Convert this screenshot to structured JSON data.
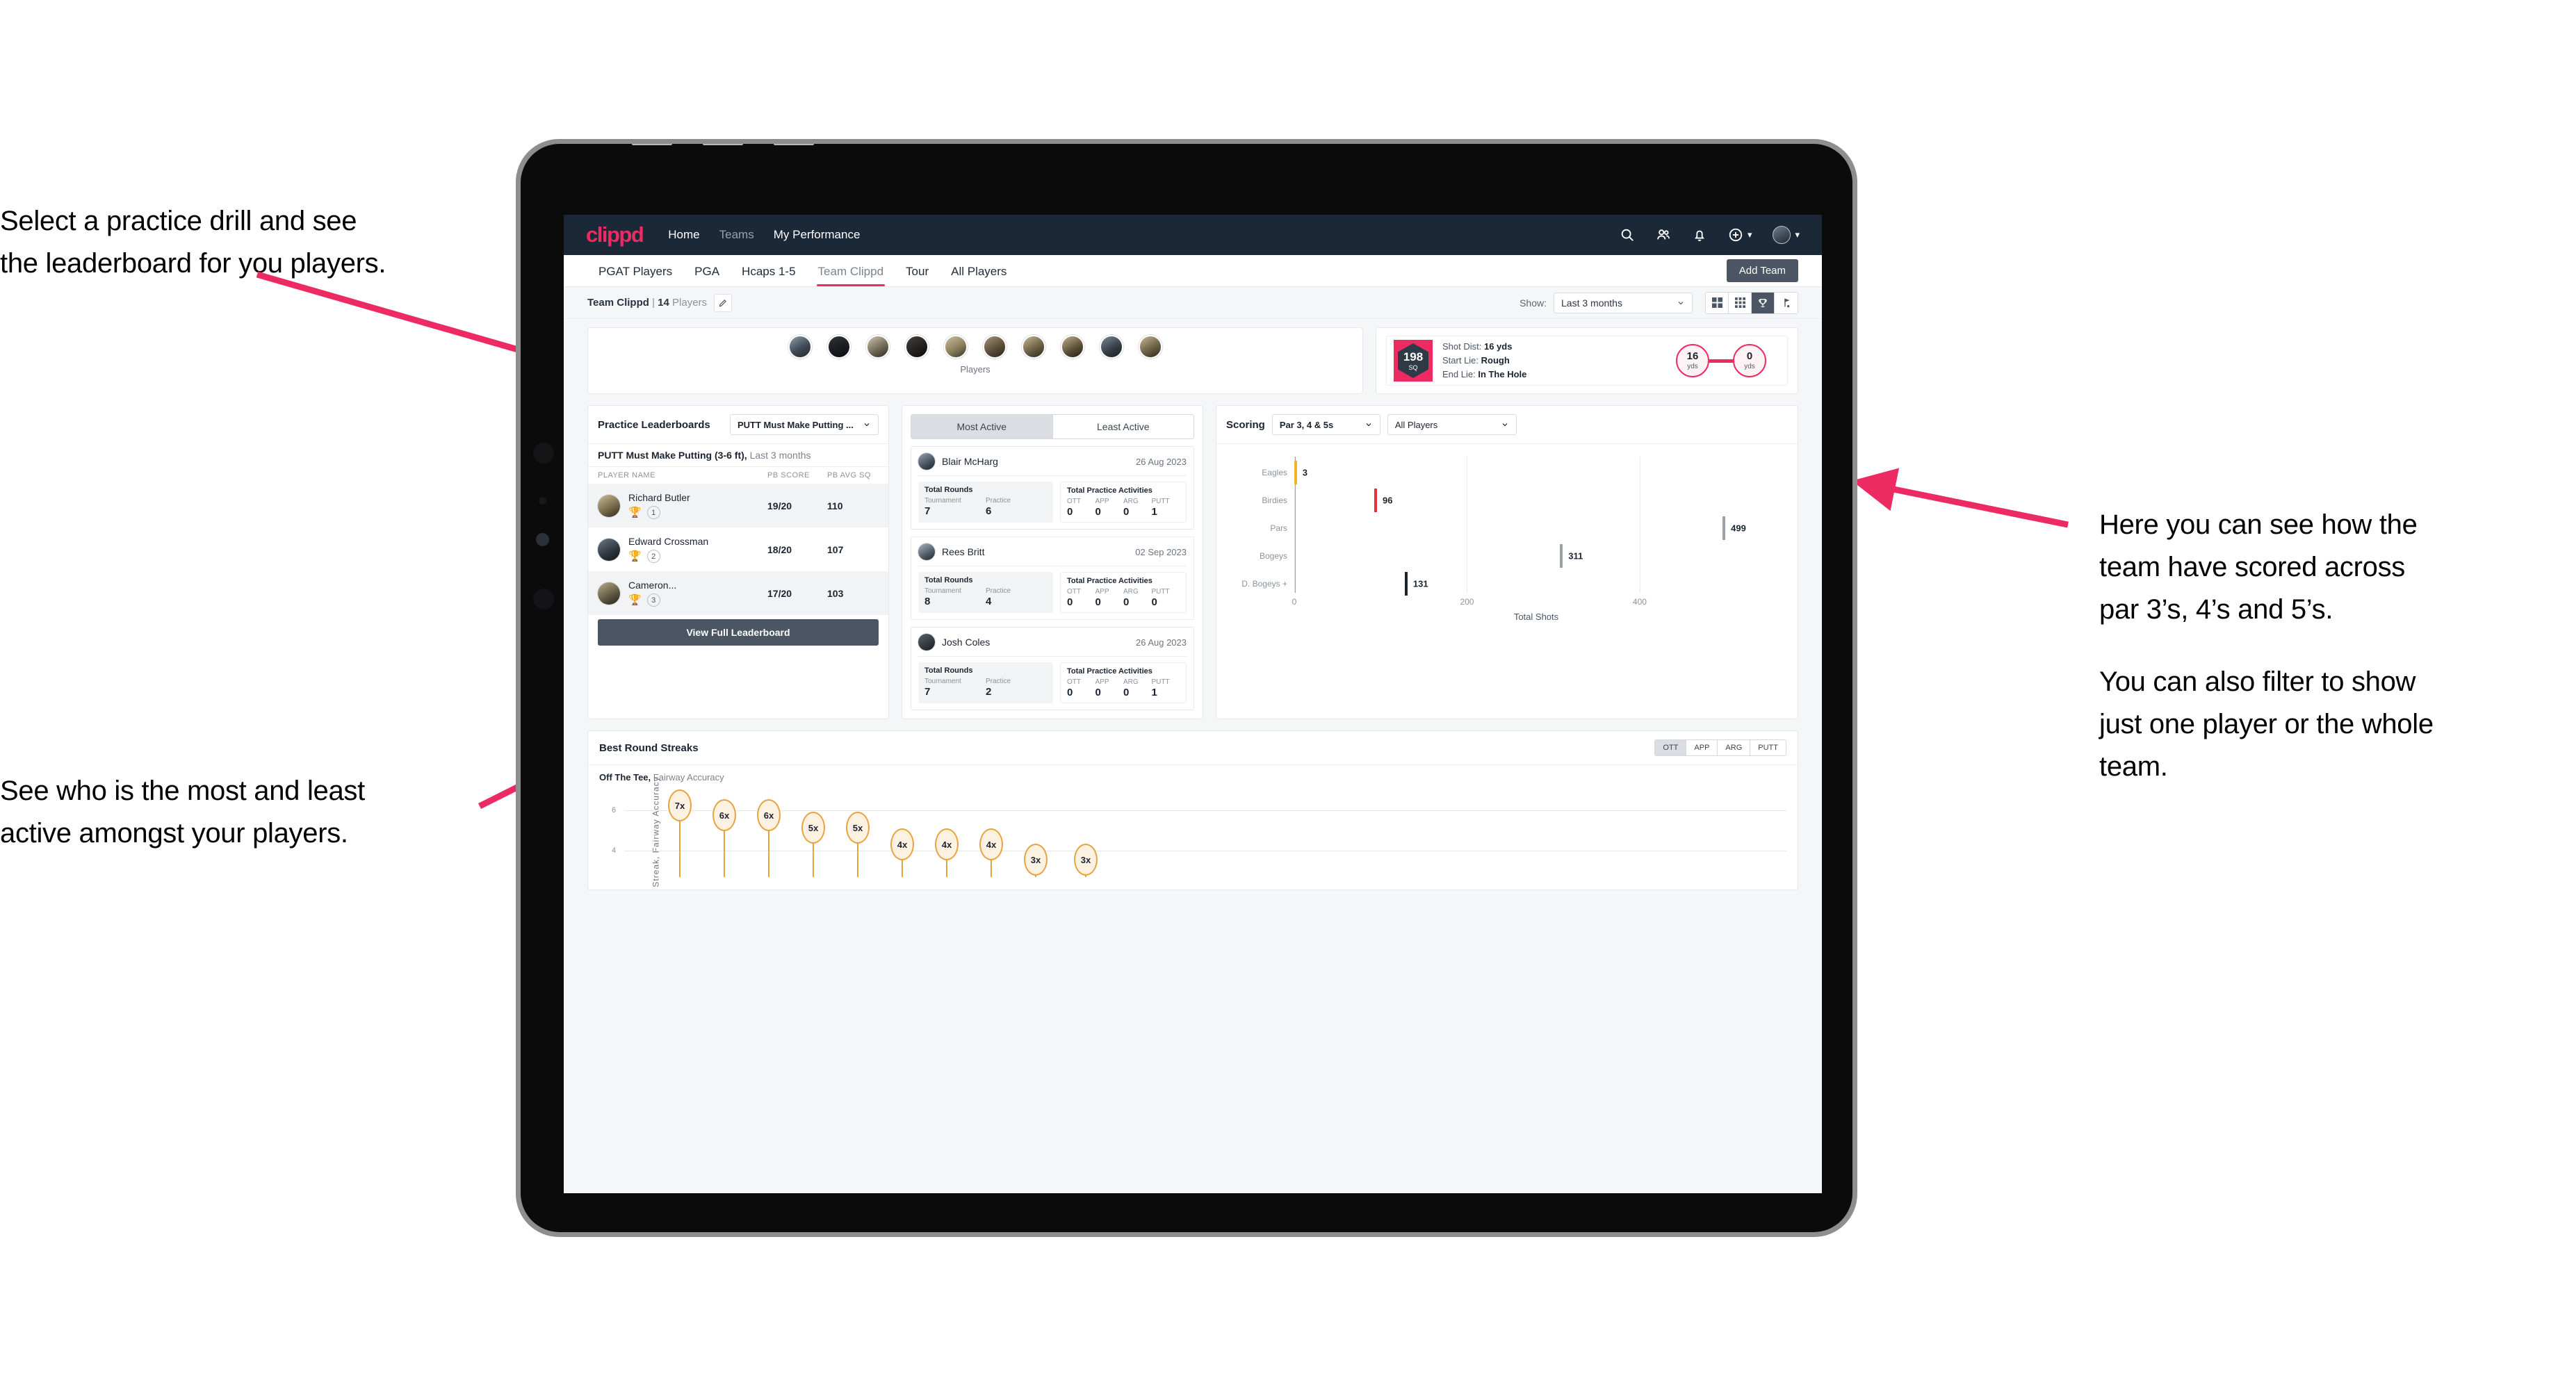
{
  "annotations": {
    "top_left": [
      "Select a practice drill and see",
      "the leaderboard for you players."
    ],
    "bottom_left": [
      "See who is the most and least",
      "active amongst your players."
    ],
    "right_p1": [
      "Here you can see how the",
      "team have scored across",
      "par 3’s, 4’s and 5’s."
    ],
    "right_p2": [
      "You can also filter to show",
      "just one player or the whole",
      "team."
    ],
    "arrow_color": "#ec2b62"
  },
  "app": {
    "logo": "clippd",
    "brand_color": "#ec2b62",
    "header_bg": "#1b2838",
    "nav": [
      {
        "label": "Home",
        "active": true
      },
      {
        "label": "Teams",
        "active": false
      },
      {
        "label": "My Performance",
        "active": true
      }
    ],
    "header_icons": [
      "search-icon",
      "people-icon",
      "bell-icon",
      "plus-circle-icon",
      "avatar"
    ],
    "tabs": [
      {
        "label": "PGAT Players",
        "active": false
      },
      {
        "label": "PGA",
        "active": false
      },
      {
        "label": "Hcaps 1-5",
        "active": false
      },
      {
        "label": "Team Clippd",
        "active": true
      },
      {
        "label": "Tour",
        "active": false
      },
      {
        "label": "All Players",
        "active": false
      }
    ],
    "add_team_label": "Add Team"
  },
  "subbar": {
    "team_name": "Team Clippd",
    "separator": "|",
    "player_count": "14",
    "players_word": "Players",
    "edit_icon": "pencil-icon",
    "show_label": "Show:",
    "range_value": "Last 3 months",
    "view_toggle": [
      {
        "icon": "grid-2x2-icon",
        "active": false
      },
      {
        "icon": "grid-3x3-icon",
        "active": false
      },
      {
        "icon": "trophy-icon",
        "active": true
      },
      {
        "icon": "flag-icon",
        "active": false
      }
    ]
  },
  "players_card": {
    "caption": "Players",
    "avatar_count": 10
  },
  "shot_card": {
    "sq_value": "198",
    "sq_unit": "SQ",
    "lines": [
      {
        "label": "Shot Dist:",
        "value": "16 yds"
      },
      {
        "label": "Start Lie:",
        "value": "Rough"
      },
      {
        "label": "End Lie:",
        "value": "In The Hole"
      }
    ],
    "start": {
      "value": "16",
      "unit": "yds"
    },
    "end": {
      "value": "0",
      "unit": "yds"
    }
  },
  "leaderboard": {
    "title": "Practice Leaderboards",
    "drill_select": "PUTT Must Make Putting ...",
    "subtitle_bold": "PUTT Must Make Putting (3-6 ft),",
    "subtitle_grey": "Last 3 months",
    "columns": [
      "PLAYER NAME",
      "PB SCORE",
      "PB AVG SQ"
    ],
    "rows": [
      {
        "name": "Richard Butler",
        "rank": "1",
        "trophy": "gold",
        "pb_score": "19/20",
        "pb_avg_sq": "110"
      },
      {
        "name": "Edward Crossman",
        "rank": "2",
        "trophy": "silver",
        "pb_score": "18/20",
        "pb_avg_sq": "107"
      },
      {
        "name": "Cameron...",
        "rank": "3",
        "trophy": "bronze",
        "pb_score": "17/20",
        "pb_avg_sq": "103"
      }
    ],
    "button_label": "View Full Leaderboard"
  },
  "activity": {
    "tabs": [
      {
        "label": "Most Active",
        "active": true
      },
      {
        "label": "Least Active",
        "active": false
      }
    ],
    "rounds_title": "Total Rounds",
    "rounds_cols": [
      "Tournament",
      "Practice"
    ],
    "practice_title": "Total Practice Activities",
    "practice_cols": [
      "OTT",
      "APP",
      "ARG",
      "PUTT"
    ],
    "players": [
      {
        "name": "Blair McHarg",
        "date": "26 Aug 2023",
        "tournament": "7",
        "practice": "6",
        "ott": "0",
        "app": "0",
        "arg": "0",
        "putt": "1"
      },
      {
        "name": "Rees Britt",
        "date": "02 Sep 2023",
        "tournament": "8",
        "practice": "4",
        "ott": "0",
        "app": "0",
        "arg": "0",
        "putt": "0"
      },
      {
        "name": "Josh Coles",
        "date": "26 Aug 2023",
        "tournament": "7",
        "practice": "2",
        "ott": "0",
        "app": "0",
        "arg": "0",
        "putt": "1"
      }
    ]
  },
  "scoring": {
    "title": "Scoring",
    "par_select": "Par 3, 4 & 5s",
    "players_select": "All Players"
  },
  "streaks": {
    "title": "Best Round Streaks",
    "toggle": [
      {
        "label": "OTT",
        "active": true
      },
      {
        "label": "APP",
        "active": false
      },
      {
        "label": "ARG",
        "active": false
      },
      {
        "label": "PUTT",
        "active": false
      }
    ],
    "sub_bold": "Off The Tee,",
    "sub_grey": "Fairway Accuracy"
  },
  "chart_data": [
    {
      "type": "bar",
      "orientation": "horizontal",
      "title": "Scoring",
      "categories": [
        "Eagles",
        "Birdies",
        "Pars",
        "Bogeys",
        "D. Bogeys +"
      ],
      "values": [
        3,
        96,
        499,
        311,
        131
      ],
      "cap_colors": [
        "#f0b429",
        "#e8313f",
        "#9aa1a9",
        "#9aa1a9",
        "#1b2430"
      ],
      "xlabel": "Total Shots",
      "ylabel": "",
      "xlim": [
        0,
        560
      ],
      "xticks": [
        0,
        200,
        400
      ],
      "grid": true,
      "legend": "none"
    },
    {
      "type": "scatter",
      "title": "Best Round Streaks",
      "subtitle": "Off The Tee, Fairway Accuracy",
      "ylabel": "Streak, Fairway Accuracy",
      "xlabel": "",
      "yticks": [
        4,
        6
      ],
      "ylim": [
        0,
        8
      ],
      "grid": true,
      "values": [
        7,
        6,
        6,
        5,
        5,
        4,
        4,
        4,
        3,
        3
      ],
      "labels": [
        "7x",
        "6x",
        "6x",
        "5x",
        "5x",
        "4x",
        "4x",
        "4x",
        "3x",
        "3x"
      ],
      "marker_color": "#e8a33d",
      "marker_fill": "#fdf1e2"
    }
  ]
}
